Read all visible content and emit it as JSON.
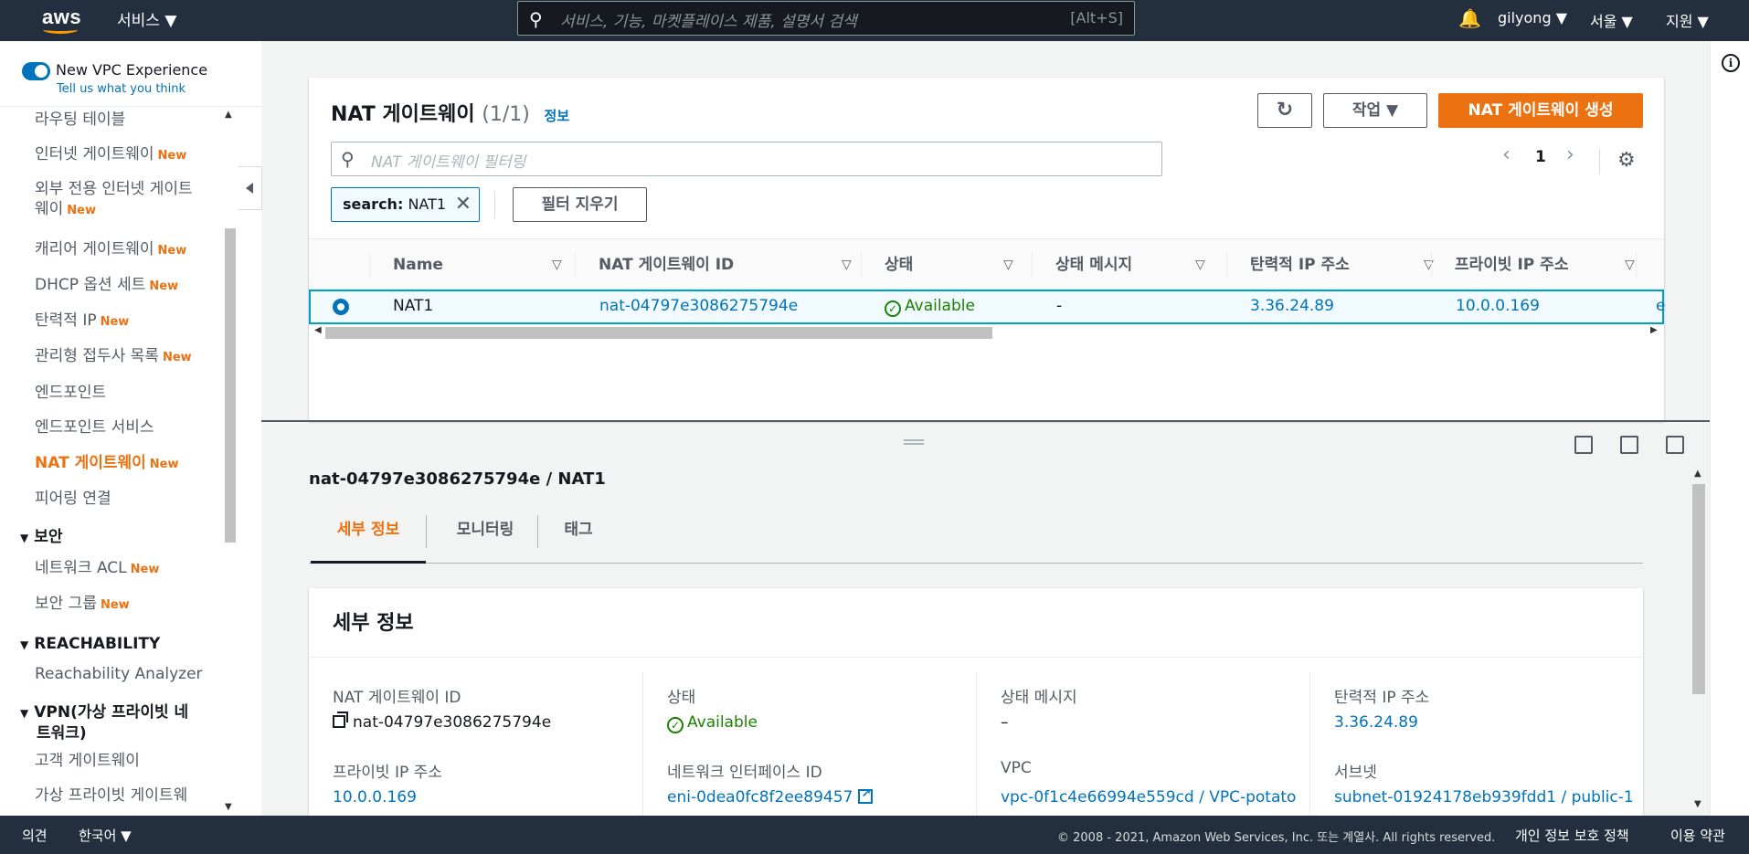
{
  "topnav": {
    "logo": "aws",
    "services_menu": "서비스 ▼",
    "search_placeholder": "서비스, 기능, 마켓플레이스 제품, 설명서 검색",
    "search_shortcut": "[Alt+S]",
    "user": "gilyong ▼",
    "region": "서울 ▼",
    "support": "지원 ▼"
  },
  "sidebar": {
    "vpc_experience": "New VPC Experience",
    "feedback": "Tell us what you think",
    "new_badge": "New",
    "items": [
      {
        "label": "라우팅 테이블",
        "new": false
      },
      {
        "label": "인터넷 게이트웨이",
        "new": true
      },
      {
        "label": "외부 전용 인터넷 게이트",
        "label2": "웨이",
        "new": true
      },
      {
        "label": "캐리어 게이트웨이",
        "new": true
      },
      {
        "label": "DHCP 옵션 세트",
        "new": true
      },
      {
        "label": "탄력적 IP",
        "new": true
      },
      {
        "label": "관리형 접두사 목록",
        "new": true
      },
      {
        "label": "엔드포인트",
        "new": false
      },
      {
        "label": "엔드포인트 서비스",
        "new": false
      },
      {
        "label": "NAT 게이트웨이",
        "new": true,
        "active": true
      },
      {
        "label": "피어링 연결",
        "new": false
      }
    ],
    "security_section": "보안",
    "security_items": [
      {
        "label": "네트워크 ACL",
        "new": true
      },
      {
        "label": "보안 그룹",
        "new": true
      }
    ],
    "reachability_section": "REACHABILITY",
    "reachability_items": [
      {
        "label": "Reachability Analyzer"
      }
    ],
    "vpn_section_line1": "VPN(가상 프라이빗 네",
    "vpn_section_line2": "트워크)",
    "vpn_items": [
      {
        "label": "고객 게이트웨이"
      },
      {
        "label": "가상 프라이빗 게이트웨"
      }
    ]
  },
  "main": {
    "title": "NAT 게이트웨이",
    "count": "(1/1)",
    "info_link": "정보",
    "actions_button": "작업 ▼",
    "create_button": "NAT 게이트웨이 생성",
    "filter_placeholder": "NAT 게이트웨이 필터링",
    "page_number": "1",
    "filter_token_key": "search:",
    "filter_token_value": "NAT1",
    "clear_filter_button": "필터 지우기",
    "columns": [
      "Name",
      "NAT 게이트웨이 ID",
      "상태",
      "상태 메시지",
      "탄력적 IP 주소",
      "프라이빗 IP 주소"
    ],
    "rows": [
      {
        "name": "NAT1",
        "id": "nat-04797e3086275794e",
        "status": "Available",
        "status_message": "-",
        "elastic_ip": "3.36.24.89",
        "private_ip": "10.0.0.169",
        "clipped": "e"
      }
    ]
  },
  "detail": {
    "header": "nat-04797e3086275794e / NAT1",
    "tabs": [
      "세부 정보",
      "모니터링",
      "태그"
    ],
    "card_title": "세부 정보",
    "fields": {
      "nat_id_label": "NAT 게이트웨이 ID",
      "nat_id_value": "nat-04797e3086275794e",
      "status_label": "상태",
      "status_value": "Available",
      "status_msg_label": "상태 메시지",
      "status_msg_value": "–",
      "eip_label": "탄력적 IP 주소",
      "eip_value": "3.36.24.89",
      "private_ip_label": "프라이빗 IP 주소",
      "private_ip_value": "10.0.0.169",
      "eni_label": "네트워크 인터페이스 ID",
      "eni_value": "eni-0dea0fc8f2ee89457",
      "vpc_label": "VPC",
      "vpc_value": "vpc-0f1c4e66994e559cd / VPC-potato",
      "subnet_label": "서브넷",
      "subnet_value": "subnet-01924178eb939fdd1 / public-1"
    }
  },
  "footer": {
    "feedback": "의견",
    "language": "한국어 ▼",
    "copyright": "© 2008 - 2021, Amazon Web Services, Inc. 또는 계열사. All rights reserved.",
    "privacy": "개인 정보 보호 정책",
    "terms": "이용 약관"
  },
  "colors": {
    "nav_bg": "#232f3e",
    "accent_orange": "#ec7211",
    "link_blue": "#0073bb",
    "success_green": "#1d8102"
  },
  "icons": [
    "search-icon",
    "bell-icon",
    "refresh-icon",
    "gear-icon",
    "close-icon",
    "info-icon",
    "copy-icon",
    "external-link-icon",
    "caret-down-icon",
    "chevron-left-icon",
    "chevron-right-icon",
    "status-check-icon"
  ]
}
